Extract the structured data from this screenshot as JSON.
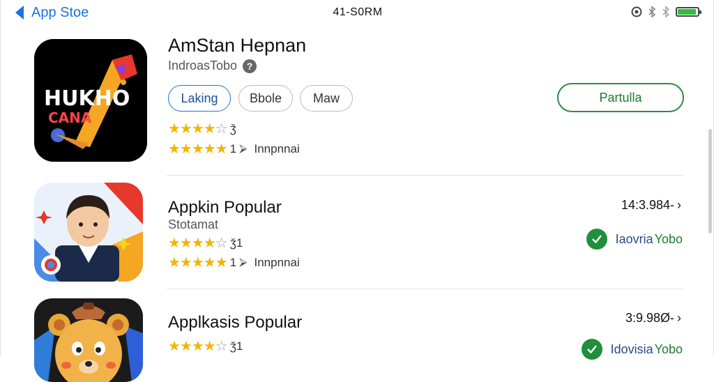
{
  "status_bar": {
    "back_label": "App Stoe",
    "time": "41-S0RM"
  },
  "colors": {
    "accent": "#1a73e8",
    "star": "#f4b400",
    "installed_green": "#1f8f3a",
    "battery_green": "#2fbf3a"
  },
  "apps": [
    {
      "title": "AmStan Hepnan",
      "subtitle": "IndroasTobo",
      "icon_name": "game-app-icon",
      "icon_text_1": "HUKHO",
      "icon_text_2": "CANA",
      "chips": [
        "Laking",
        "Bbole",
        "Maw"
      ],
      "action_label": "Partulla",
      "rating1": {
        "stars": 4,
        "count": "ǯ"
      },
      "rating2": {
        "stars": 5,
        "count": "1",
        "label": "Innpnnai"
      }
    },
    {
      "title": "Appkin Popular",
      "subtitle": "Stotamat",
      "icon_name": "businessman-app-icon",
      "price": "14:3.984-",
      "installed_label_1": "Iaovria",
      "installed_label_2": "Yobo",
      "rating1": {
        "stars": 4,
        "count": "ǯ1"
      },
      "rating2": {
        "stars": 5,
        "count": "1",
        "label": "Innpnnai"
      }
    },
    {
      "title": "Applkasis Popular",
      "icon_name": "bear-app-icon",
      "price": "3:9.98Ø-",
      "installed_label_1": "Idovisia",
      "installed_label_2": "Yobo",
      "rating1": {
        "stars": 4,
        "count": "ǯ1"
      }
    }
  ]
}
